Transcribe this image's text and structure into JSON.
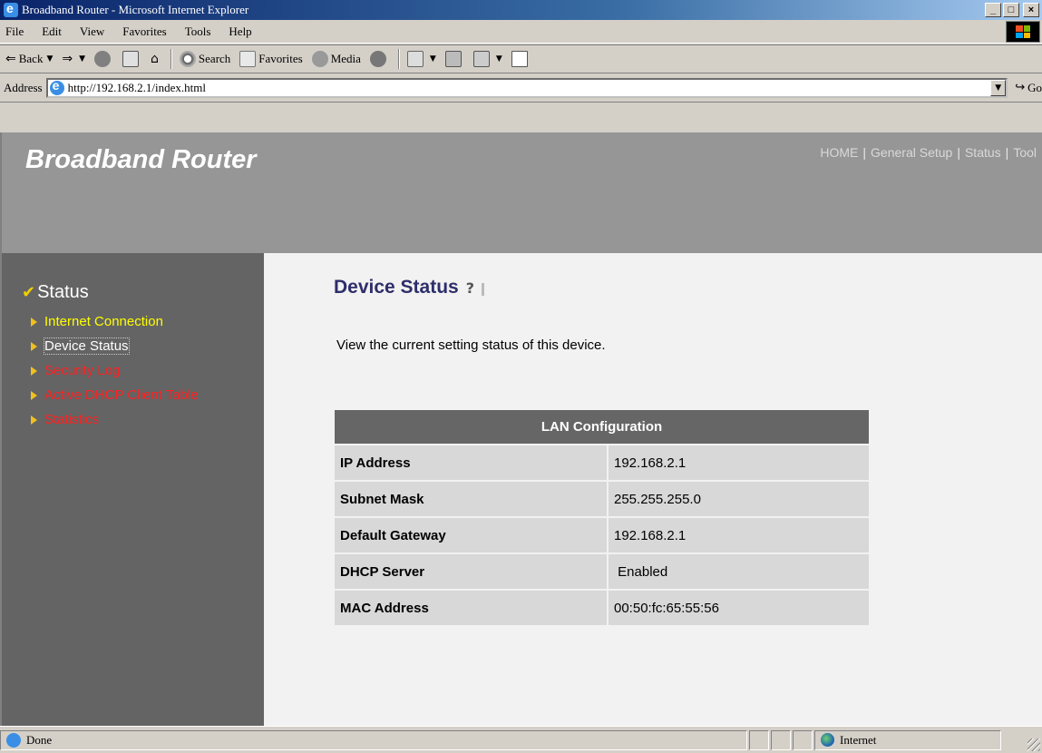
{
  "window": {
    "title": "Broadband Router - Microsoft Internet Explorer",
    "min_label": "_",
    "max_label": "□",
    "close_label": "×"
  },
  "menu": [
    "File",
    "Edit",
    "View",
    "Favorites",
    "Tools",
    "Help"
  ],
  "toolbar": {
    "back": "Back",
    "search": "Search",
    "favorites": "Favorites",
    "media": "Media"
  },
  "address": {
    "label": "Address",
    "url": "http://192.168.2.1/index.html",
    "go": "Go"
  },
  "page": {
    "brand": "Broadband Router",
    "nav": [
      "HOME",
      "General Setup",
      "Status",
      "Tool"
    ],
    "sidebar": {
      "heading": "Status",
      "items": [
        {
          "label": "Internet Connection",
          "color": "#ffff00"
        },
        {
          "label": "Device Status",
          "color": "#ffffff"
        },
        {
          "label": "Security Log",
          "color": "#ff2020"
        },
        {
          "label": "Active DHCP Client Table",
          "color": "#ff2020"
        },
        {
          "label": "Statistics",
          "color": "#ff2020"
        }
      ]
    },
    "title": "Device Status",
    "description": "View the current setting status of this device.",
    "table": {
      "header": "LAN Configuration",
      "rows": [
        {
          "key": "IP Address",
          "value": "192.168.2.1"
        },
        {
          "key": "Subnet Mask",
          "value": "255.255.255.0"
        },
        {
          "key": "Default Gateway",
          "value": "192.168.2.1"
        },
        {
          "key": "DHCP Server",
          "value": " Enabled"
        },
        {
          "key": "MAC Address",
          "value": "00:50:fc:65:55:56"
        }
      ]
    }
  },
  "status": {
    "left": "Done",
    "zone": "Internet"
  }
}
